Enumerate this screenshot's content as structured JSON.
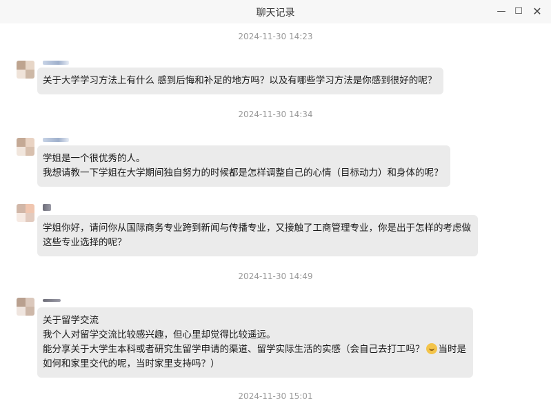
{
  "window": {
    "title": "聊天记录",
    "controls": {
      "minimize": "—",
      "maximize": "☐",
      "close": "✕"
    }
  },
  "messages": [
    {
      "timestamp": "2024-11-30 14:23",
      "lines": [
        "关于大学学习方法上有什么  感到后悔和补足的地方吗？以及有哪些学习方法是你感到很好的呢？"
      ]
    },
    {
      "timestamp": "2024-11-30 14:34",
      "lines": [
        "学姐是一个很优秀的人。",
        "我想请教一下学姐在大学期间独自努力的时候都是怎样调整自己的心情（目标动力）和身体的呢？"
      ]
    },
    {
      "timestamp": "",
      "lines": [
        "学姐你好，请问你从国际商务专业跨到新闻与传播专业，又接触了工商管理专业，你是出于怎样的考虑做",
        "这些专业选择的呢？"
      ]
    },
    {
      "timestamp": "2024-11-30 14:49",
      "lines": [
        "关于留学交流",
        "我个人对留学交流比较感兴趣，但心里却觉得比较遥远。",
        "能分享关于大学生本科或者研究生留学申请的渠道、留学实际生活的实感（会自己去打工吗？",
        "如何和家里交代的呢，当时家里支持吗？）"
      ],
      "line3_tail": "当时是"
    },
    {
      "timestamp": "2024-11-30 15:01",
      "lines": []
    }
  ]
}
